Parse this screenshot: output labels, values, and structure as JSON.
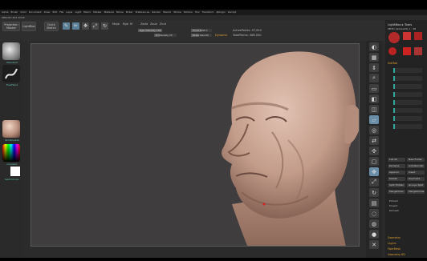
{
  "app": {
    "title_text": "ZBRUSH 4R5 SHOP"
  },
  "menu": [
    "Alpha",
    "Brush",
    "Color",
    "Document",
    "Draw",
    "Edit",
    "File",
    "Layer",
    "Light",
    "Macro",
    "Marker",
    "Material",
    "Movie",
    "Picker",
    "Preferences",
    "Render",
    "Stencil",
    "Stroke",
    "Texture",
    "Tool",
    "Transform",
    "Zplugin",
    "Zscript"
  ],
  "shelf": {
    "projection_master": "Projection Master",
    "lightbox": "LightBox",
    "quick_sketch": "Quick Sketch",
    "edit": "Edit",
    "draw": "Draw",
    "move": "Move",
    "scale": "Scale",
    "rotate": "Rotate",
    "mrgb": "Mrgb",
    "rgb": "Rgb",
    "m": "M",
    "zadd": "Zadd",
    "zsub": "Zsub",
    "zcut": "Zcut",
    "focal_shift": "Focal Shift 0",
    "draw_size": "Draw Size 64",
    "dynamic": "Dynamic",
    "active_points": "ActivePoints: 97,610",
    "total_points": "TotalPoints: 488,050",
    "z_intensity": "Z Intensity 25",
    "rgb_intensity": "Rgb Intensity 100"
  },
  "left": {
    "brush_label": "Standard",
    "stroke_label": "FreeHand",
    "material_label": "SkinShade4",
    "gradient_label": "Gradient",
    "switch_color": "SwitchColor"
  },
  "right_shelf": [
    "BPR",
    "SPix 3",
    "Scroll",
    "Zoom",
    "Actual",
    "AAHalf",
    "Persp",
    "Floor",
    "Local",
    "L.Sym",
    "Xyz",
    "Frame",
    "Move",
    "Scale",
    "Rotate",
    "PolyF",
    "Transp",
    "Ghost",
    "Solo",
    "Xpose"
  ],
  "tray": {
    "title": "LightBox ▸ Tools",
    "tool_name": "PM3D_Sphere3D_1 : 48",
    "subtool_hdr": "SubTool",
    "list_all": "List All",
    "new_folder": "New Folder",
    "rename": "Rename",
    "auto_reorder": "AutoReorder",
    "append": "Append",
    "insert": "Insert",
    "delete": "Delete",
    "duplicate": "Duplicate",
    "split_hidden": "Split Hidden",
    "groups_split": "Groups Split",
    "merge_down": "MergeDown",
    "merge_similar": "MergeSimilar",
    "extract": "Extract",
    "project": "Project",
    "remesh": "Remesh",
    "geometry": "Geometry",
    "layers": "Layers",
    "fibermesh": "FiberMesh",
    "geometry_hd": "Geometry HD"
  },
  "colors": {
    "accent": "#2fa8a0",
    "canvas_bg": "#3f3d3e",
    "skin": "#c9a594",
    "highlight": "#e0a030"
  }
}
